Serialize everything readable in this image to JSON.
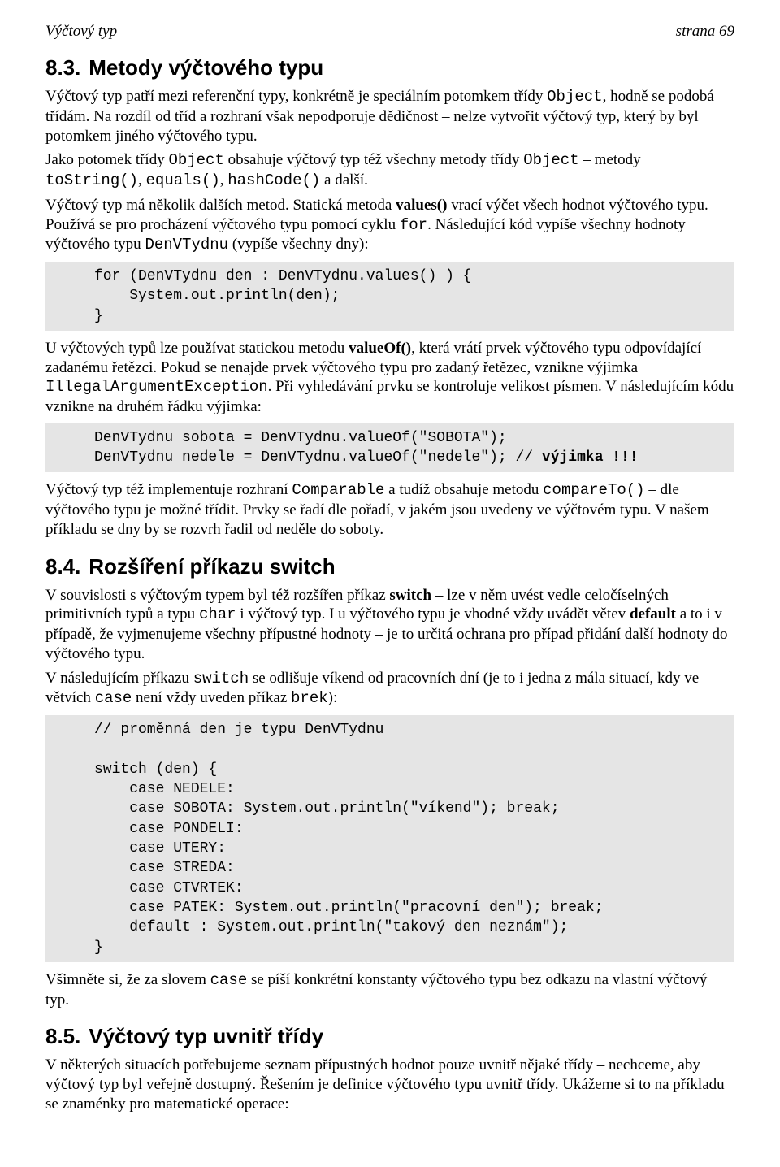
{
  "header": {
    "left": "Výčtový typ",
    "right": "strana 69"
  },
  "s83": {
    "num": "8.3.",
    "title": "Metody výčtového typu",
    "p1a": "Výčtový typ patří mezi referenční typy, konkrétně je speciálním potomkem třídy ",
    "p1b": "Object",
    "p1c": ", hodně se podobá třídám. Na rozdíl od tříd a rozhraní však nepodporuje dědičnost – nelze vytvořit výčtový typ, který by byl potomkem jiného výčtového typu.",
    "p2a": "Jako potomek třídy ",
    "p2b": "Object",
    "p2c": " obsahuje výčtový typ též všechny metody třídy ",
    "p2d": "Object",
    "p2e": " – metody ",
    "p2f": "toString()",
    "p2g": ", ",
    "p2h": "equals()",
    "p2i": ", ",
    "p2j": "hashCode()",
    "p2k": " a další.",
    "p3a": "Výčtový typ má několik dalších metod. Statická metoda ",
    "p3b": "values()",
    "p3c": " vrací výčet všech hodnot výčtového typu. Používá se pro procházení výčtového typu pomocí cyklu ",
    "p3d": "for",
    "p3e": ". Následující kód vypíše všechny hodnoty výčtového typu ",
    "p3f": "DenVTydnu",
    "p3g": " (vypíše všechny dny):",
    "code1": "for (DenVTydnu den : DenVTydnu.values() ) {\n    System.out.println(den);\n}",
    "p4a": "U výčtových typů lze používat statickou metodu ",
    "p4b": "valueOf()",
    "p4c": ", která vrátí prvek výčtového typu odpovídající zadanému řetězci. Pokud se nenajde prvek výčtového typu pro zadaný řetězec, vznikne výjimka ",
    "p4d": "IllegalArgumentException",
    "p4e": ". Při vyhledávání prvku se kontroluje velikost písmen. V následujícím kódu vznikne na druhém řádku výjimka:",
    "code2a": "DenVTydnu sobota = DenVTydnu.valueOf(\"SOBOTA\");\nDenVTydnu nedele = DenVTydnu.valueOf(\"nedele\"); // ",
    "code2b": "výjimka !!!",
    "p5a": "Výčtový typ též implementuje rozhraní ",
    "p5b": "Comparable",
    "p5c": " a tudíž obsahuje metodu ",
    "p5d": "compareTo()",
    "p5e": " – dle výčtového typu je možné třídit. Prvky se řadí dle pořadí, v jakém jsou uvedeny ve výčtovém typu. V našem příkladu se dny by se rozvrh řadil od neděle do soboty."
  },
  "s84": {
    "num": "8.4.",
    "title": "Rozšíření příkazu switch",
    "p1a": "V souvislosti s výčtovým typem byl též rozšířen příkaz ",
    "p1b": "switch",
    "p1c": " – lze v něm uvést vedle celočíselných primitivních typů a typu ",
    "p1d": "char",
    "p1e": " i výčtový typ. I u výčtového typu je vhodné vždy uvádět větev ",
    "p1f": "default",
    "p1g": " a to i v případě, že vyjmenujeme všechny přípustné hodnoty – je to určitá ochrana pro případ přidání další hodnoty do výčtového typu.",
    "p2a": "V následujícím příkazu ",
    "p2b": "switch",
    "p2c": " se odlišuje víkend od pracovních dní (je to i jedna z mála situací, kdy ve větvích ",
    "p2d": "case",
    "p2e": " není vždy uveden příkaz ",
    "p2f": "brek",
    "p2g": "):",
    "code1": "// proměnná den je typu DenVTydnu\n\nswitch (den) {\n    case NEDELE:\n    case SOBOTA: System.out.println(\"víkend\"); break;\n    case PONDELI:\n    case UTERY:\n    case STREDA:\n    case CTVRTEK:\n    case PATEK: System.out.println(\"pracovní den\"); break;\n    default : System.out.println(\"takový den neznám\");\n}",
    "p3a": "Všimněte si, že za slovem ",
    "p3b": "case",
    "p3c": " se píší konkrétní konstanty výčtového typu bez odkazu na vlastní výčtový typ."
  },
  "s85": {
    "num": "8.5.",
    "title": "Výčtový typ uvnitř třídy",
    "p1": "V některých situacích potřebujeme seznam přípustných hodnot pouze uvnitř nějaké třídy – nechceme, aby výčtový typ byl veřejně dostupný. Řešením je definice výčtového typu uvnitř třídy. Ukážeme si to na příkladu se znaménky pro matematické operace:"
  }
}
